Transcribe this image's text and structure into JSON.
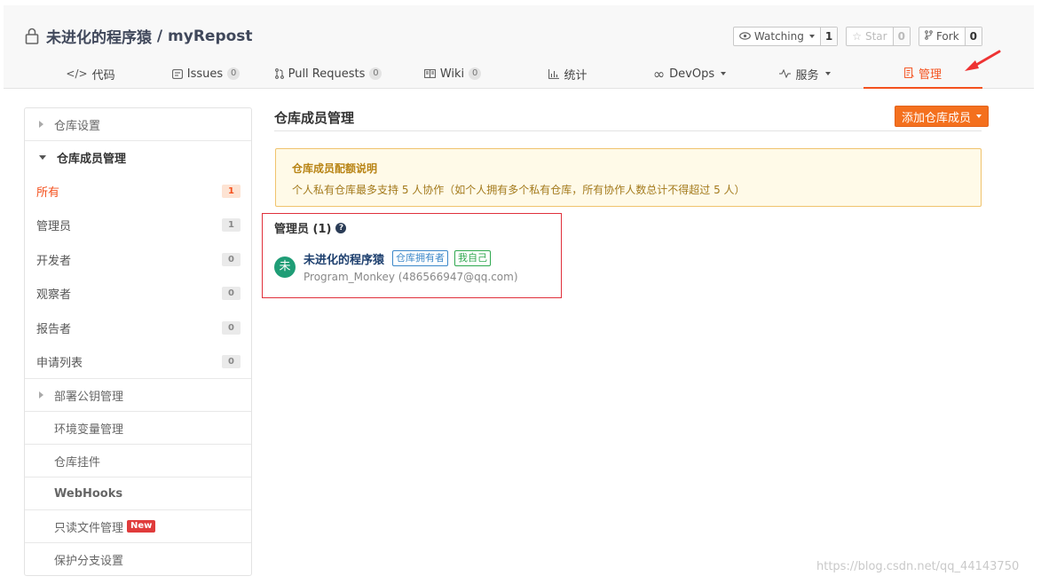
{
  "repo": {
    "owner": "未进化的程序猿",
    "separator": " / ",
    "name": "myRepost"
  },
  "actions": {
    "watching_label": "Watching",
    "watching_count": "1",
    "star_label": "Star",
    "star_count": "0",
    "fork_label": "Fork",
    "fork_count": "0"
  },
  "tabs": [
    {
      "label": "代码",
      "icon": "code-icon",
      "badge": ""
    },
    {
      "label": "Issues",
      "icon": "issues-icon",
      "badge": "0"
    },
    {
      "label": "Pull Requests",
      "icon": "pull-request-icon",
      "badge": "0"
    },
    {
      "label": "Wiki",
      "icon": "wiki-icon",
      "badge": "0"
    },
    {
      "label": "统计",
      "icon": "chart-icon",
      "badge": ""
    },
    {
      "label": "DevOps",
      "icon": "infinity-icon",
      "badge": ""
    },
    {
      "label": "服务",
      "icon": "pulse-icon",
      "badge": ""
    },
    {
      "label": "管理",
      "icon": "manage-icon",
      "badge": ""
    }
  ],
  "sidebar": {
    "repo_settings": "仓库设置",
    "member_manage": "仓库成员管理",
    "member_filters": [
      {
        "label": "所有",
        "count": "1"
      },
      {
        "label": "管理员",
        "count": "1"
      },
      {
        "label": "开发者",
        "count": "0"
      },
      {
        "label": "观察者",
        "count": "0"
      },
      {
        "label": "报告者",
        "count": "0"
      },
      {
        "label": "申请列表",
        "count": "0"
      }
    ],
    "deploy_keys": "部署公钥管理",
    "items": [
      {
        "label": "环境变量管理"
      },
      {
        "label": "仓库挂件"
      },
      {
        "label": "WebHooks"
      },
      {
        "label": "只读文件管理",
        "badge": "New"
      },
      {
        "label": "保护分支设置"
      }
    ]
  },
  "main": {
    "title": "仓库成员管理",
    "add_button": "添加仓库成员",
    "notice_title": "仓库成员配额说明",
    "notice_text": "个人私有仓库最多支持 5 人协作（如个人拥有多个私有仓库，所有协作人数总计不得超过 5 人）",
    "members_heading": "管理员 (1)",
    "help_icon": "?",
    "member": {
      "avatar_char": "未",
      "name": "未进化的程序猿",
      "tag_owner": "仓库拥有者",
      "tag_self": "我自己",
      "sub": "Program_Monkey (486566947@qq.com)"
    }
  },
  "watermark": "https://blog.csdn.net/qq_44143750",
  "colors": {
    "accent": "#f4511e",
    "annotation_red": "#e0303b"
  }
}
